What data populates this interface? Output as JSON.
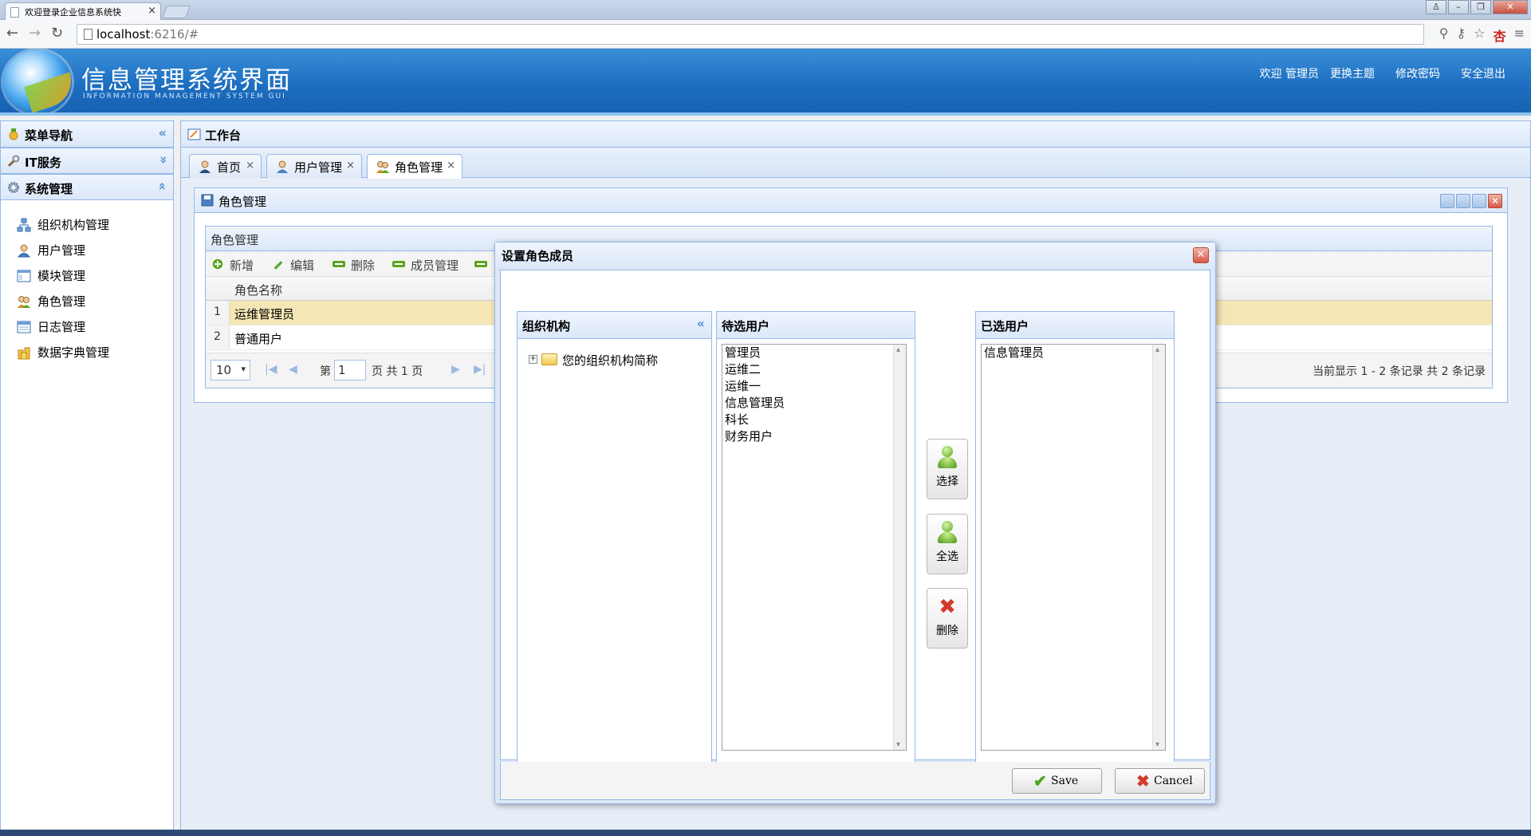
{
  "browser": {
    "tab_title": "欢迎登录企业信息系统快",
    "url_host": "localhost",
    "url_path": ":6216/#"
  },
  "header": {
    "title": "信息管理系统界面",
    "subtitle": "INFORMATION MANAGEMENT SYSTEM GUI",
    "links": [
      "欢迎 管理员",
      "更换主题",
      "修改密码",
      "安全退出"
    ]
  },
  "menu": {
    "title": "菜单导航",
    "groups": [
      "IT服务",
      "系统管理"
    ],
    "items": [
      "组织机构管理",
      "用户管理",
      "模块管理",
      "角色管理",
      "日志管理",
      "数据字典管理"
    ]
  },
  "workspace": {
    "title": "工作台",
    "tabs": [
      "首页",
      "用户管理",
      "角色管理"
    ]
  },
  "role_panel": {
    "title": "角色管理",
    "grid_title": "角色管理",
    "toolbar": [
      "新增",
      "编辑",
      "删除",
      "成员管理"
    ],
    "column": "角色名称",
    "rows": [
      {
        "num": "1",
        "name": "运维管理员"
      },
      {
        "num": "2",
        "name": "普通用户"
      }
    ],
    "pager": {
      "page_size": "10",
      "page_label": "第",
      "page_value": "1",
      "page_suffix": "页 共 1 页",
      "info": "当前显示 1 - 2 条记录 共 2 条记录"
    }
  },
  "dialog": {
    "title": "设置角色成员",
    "org_panel_title": "组织机构",
    "org_root": "您的组织机构简称",
    "pending_title": "待选用户",
    "pending_users": [
      "管理员",
      "运维二",
      "运维一",
      "信息管理员",
      "科长",
      "财务用户"
    ],
    "selected_title": "已选用户",
    "selected_users": [
      "信息管理员"
    ],
    "btn_select": "选择",
    "btn_select_all": "全选",
    "btn_delete": "删除",
    "save": "Save",
    "cancel": "Cancel"
  }
}
